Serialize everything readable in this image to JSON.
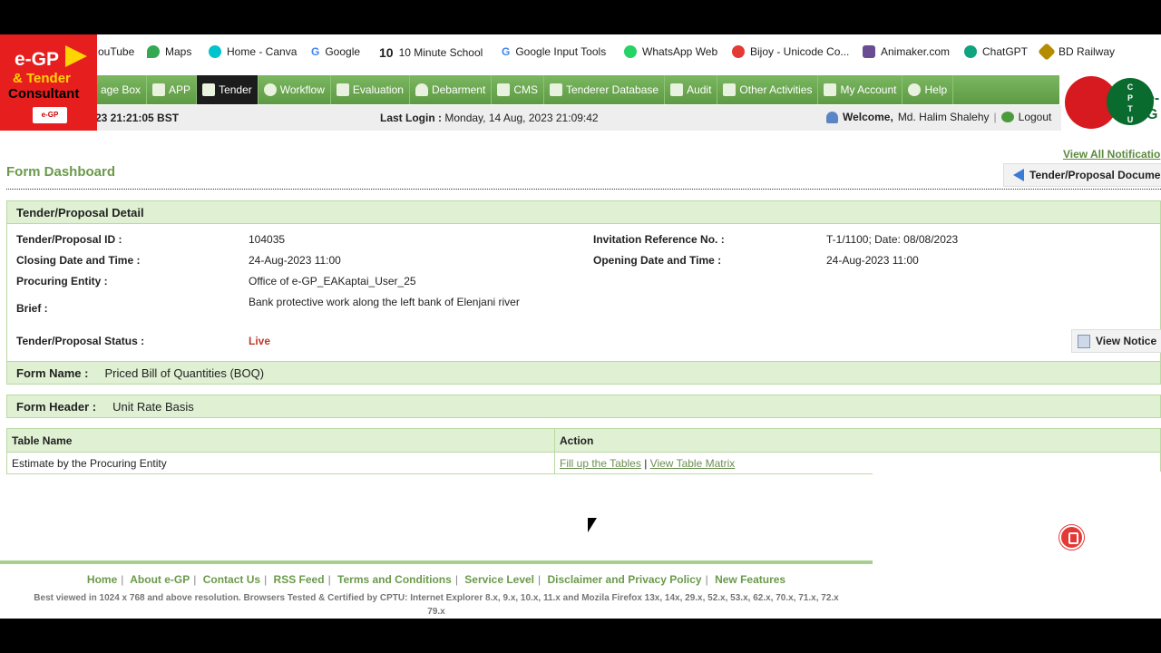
{
  "bookmarks": [
    {
      "label": "ouTube",
      "color": "#ff0000"
    },
    {
      "label": "Maps",
      "color": "#34a853"
    },
    {
      "label": "Home - Canva",
      "color": "#00c4cc"
    },
    {
      "label": "Google",
      "color": "#4285f4"
    },
    {
      "label": "10 Minute School",
      "color": "#222222"
    },
    {
      "label": "Google Input Tools",
      "color": "#4285f4"
    },
    {
      "label": "WhatsApp Web",
      "color": "#25d366"
    },
    {
      "label": "Bijoy - Unicode Co...",
      "color": "#e53935"
    },
    {
      "label": "Animaker.com",
      "color": "#6a4c93"
    },
    {
      "label": "ChatGPT",
      "color": "#10a37f"
    },
    {
      "label": "BD Railway",
      "color": "#b58b00"
    }
  ],
  "logo": {
    "line1": "e-GP",
    "line2": "& Tender",
    "line3": "Consultant",
    "mini": "e-GP"
  },
  "menu": [
    {
      "label": "age Box"
    },
    {
      "label": "APP"
    },
    {
      "label": "Tender",
      "active": true
    },
    {
      "label": "Workflow"
    },
    {
      "label": "Evaluation"
    },
    {
      "label": "Debarment"
    },
    {
      "label": "CMS"
    },
    {
      "label": "Tenderer Database"
    },
    {
      "label": "Audit"
    },
    {
      "label": "Other Activities"
    },
    {
      "label": "My Account"
    },
    {
      "label": "Help"
    }
  ],
  "brand": {
    "cptu": "C P T U",
    "egp": "e-G"
  },
  "status": {
    "clock": "23 21:21:05 BST",
    "last_login_label": "Last Login :",
    "last_login_value": "Monday, 14 Aug, 2023 21:09:42",
    "welcome_label": "Welcome,",
    "welcome_name": "Md. Halim Shalehy",
    "separator": "|",
    "logout": "Logout"
  },
  "notifications_link": "View All Notificatio",
  "page_title": "Form Dashboard",
  "tender_doc_button": "Tender/Proposal Documen",
  "detail": {
    "heading": "Tender/Proposal Detail",
    "tender_id_label": "Tender/Proposal ID :",
    "tender_id": "104035",
    "invitation_label": "Invitation Reference No. :",
    "invitation": "T-1/1100; Date: 08/08/2023",
    "closing_label": "Closing Date and Time :",
    "closing": "24-Aug-2023 11:00",
    "opening_label": "Opening Date and Time :",
    "opening": "24-Aug-2023 11:00",
    "entity_label": "Procuring Entity :",
    "entity": "Office of e-GP_EAKaptai_User_25",
    "brief_label": "Brief :",
    "brief": "Bank protective work along the left bank of Elenjani river",
    "status_label": "Tender/Proposal Status :",
    "status": "Live",
    "view_notice": "View Notice"
  },
  "form_name": {
    "label": "Form Name :",
    "value": "Priced Bill of Quantities (BOQ)"
  },
  "form_header": {
    "label": "Form Header :",
    "value": "Unit Rate Basis"
  },
  "table": {
    "headers": [
      "Table Name",
      "Action"
    ],
    "rows": [
      {
        "name": "Estimate by the Procuring Entity",
        "action1": "Fill up the Tables",
        "action_sep": "|",
        "action2": "View Table Matrix"
      }
    ]
  },
  "footer": {
    "links": [
      "Home",
      "About e-GP",
      "Contact Us",
      "RSS Feed",
      "Terms and Conditions",
      "Service Level",
      "Disclaimer and Privacy Policy",
      "New Features"
    ],
    "separator": "|",
    "note_line1": "Best viewed in 1024 x 768 and above resolution. Browsers Tested & Certified by CPTU: Internet Explorer 8.x, 9.x, 10.x, 11.x and Mozila Firefox 13x, 14x, 29.x, 52.x, 53.x, 62.x, 70.x, 71.x, 72.x",
    "note_line2": "79.x"
  }
}
